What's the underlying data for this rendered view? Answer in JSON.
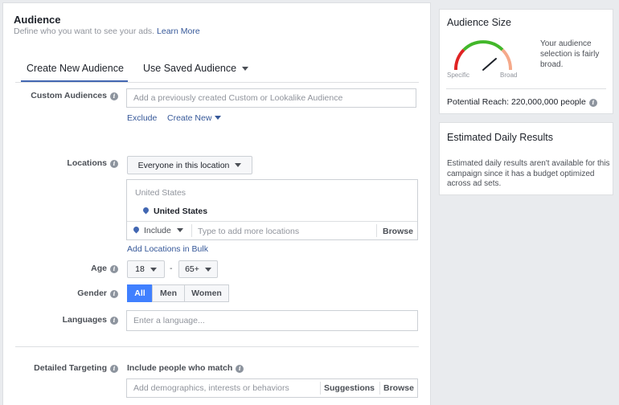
{
  "audience": {
    "title": "Audience",
    "subtitle": "Define who you want to see your ads.",
    "learn_more": "Learn More",
    "tabs": [
      {
        "label": "Create New Audience",
        "active": true
      },
      {
        "label": "Use Saved Audience",
        "active": false
      }
    ],
    "custom_audiences": {
      "label": "Custom Audiences",
      "placeholder": "Add a previously created Custom or Lookalike Audience",
      "exclude": "Exclude",
      "create_new": "Create New"
    },
    "locations": {
      "label": "Locations",
      "dropdown": "Everyone in this location",
      "group_header": "United States",
      "selected": "United States",
      "include": "Include",
      "placeholder": "Type to add more locations",
      "browse": "Browse",
      "bulk_link": "Add Locations in Bulk"
    },
    "age": {
      "label": "Age",
      "min": "18",
      "separator": "-",
      "max": "65+"
    },
    "gender": {
      "label": "Gender",
      "options": [
        "All",
        "Men",
        "Women"
      ],
      "selected": "All"
    },
    "languages": {
      "label": "Languages",
      "placeholder": "Enter a language..."
    },
    "detailed_targeting": {
      "label": "Detailed Targeting",
      "include_text": "Include people who match",
      "placeholder": "Add demographics, interests or behaviors",
      "suggestions": "Suggestions",
      "browse": "Browse"
    }
  },
  "audience_size": {
    "title": "Audience Size",
    "gauge_left": "Specific",
    "gauge_right": "Broad",
    "description": "Your audience selection is fairly broad.",
    "reach": "Potential Reach: 220,000,000 people",
    "colors": {
      "specific": "#e02424",
      "mid": "#42b72a",
      "broad": "#f5a98a"
    }
  },
  "daily_results": {
    "title": "Estimated Daily Results",
    "description": "Estimated daily results aren't available for this campaign since it has a budget optimized across ad sets."
  }
}
